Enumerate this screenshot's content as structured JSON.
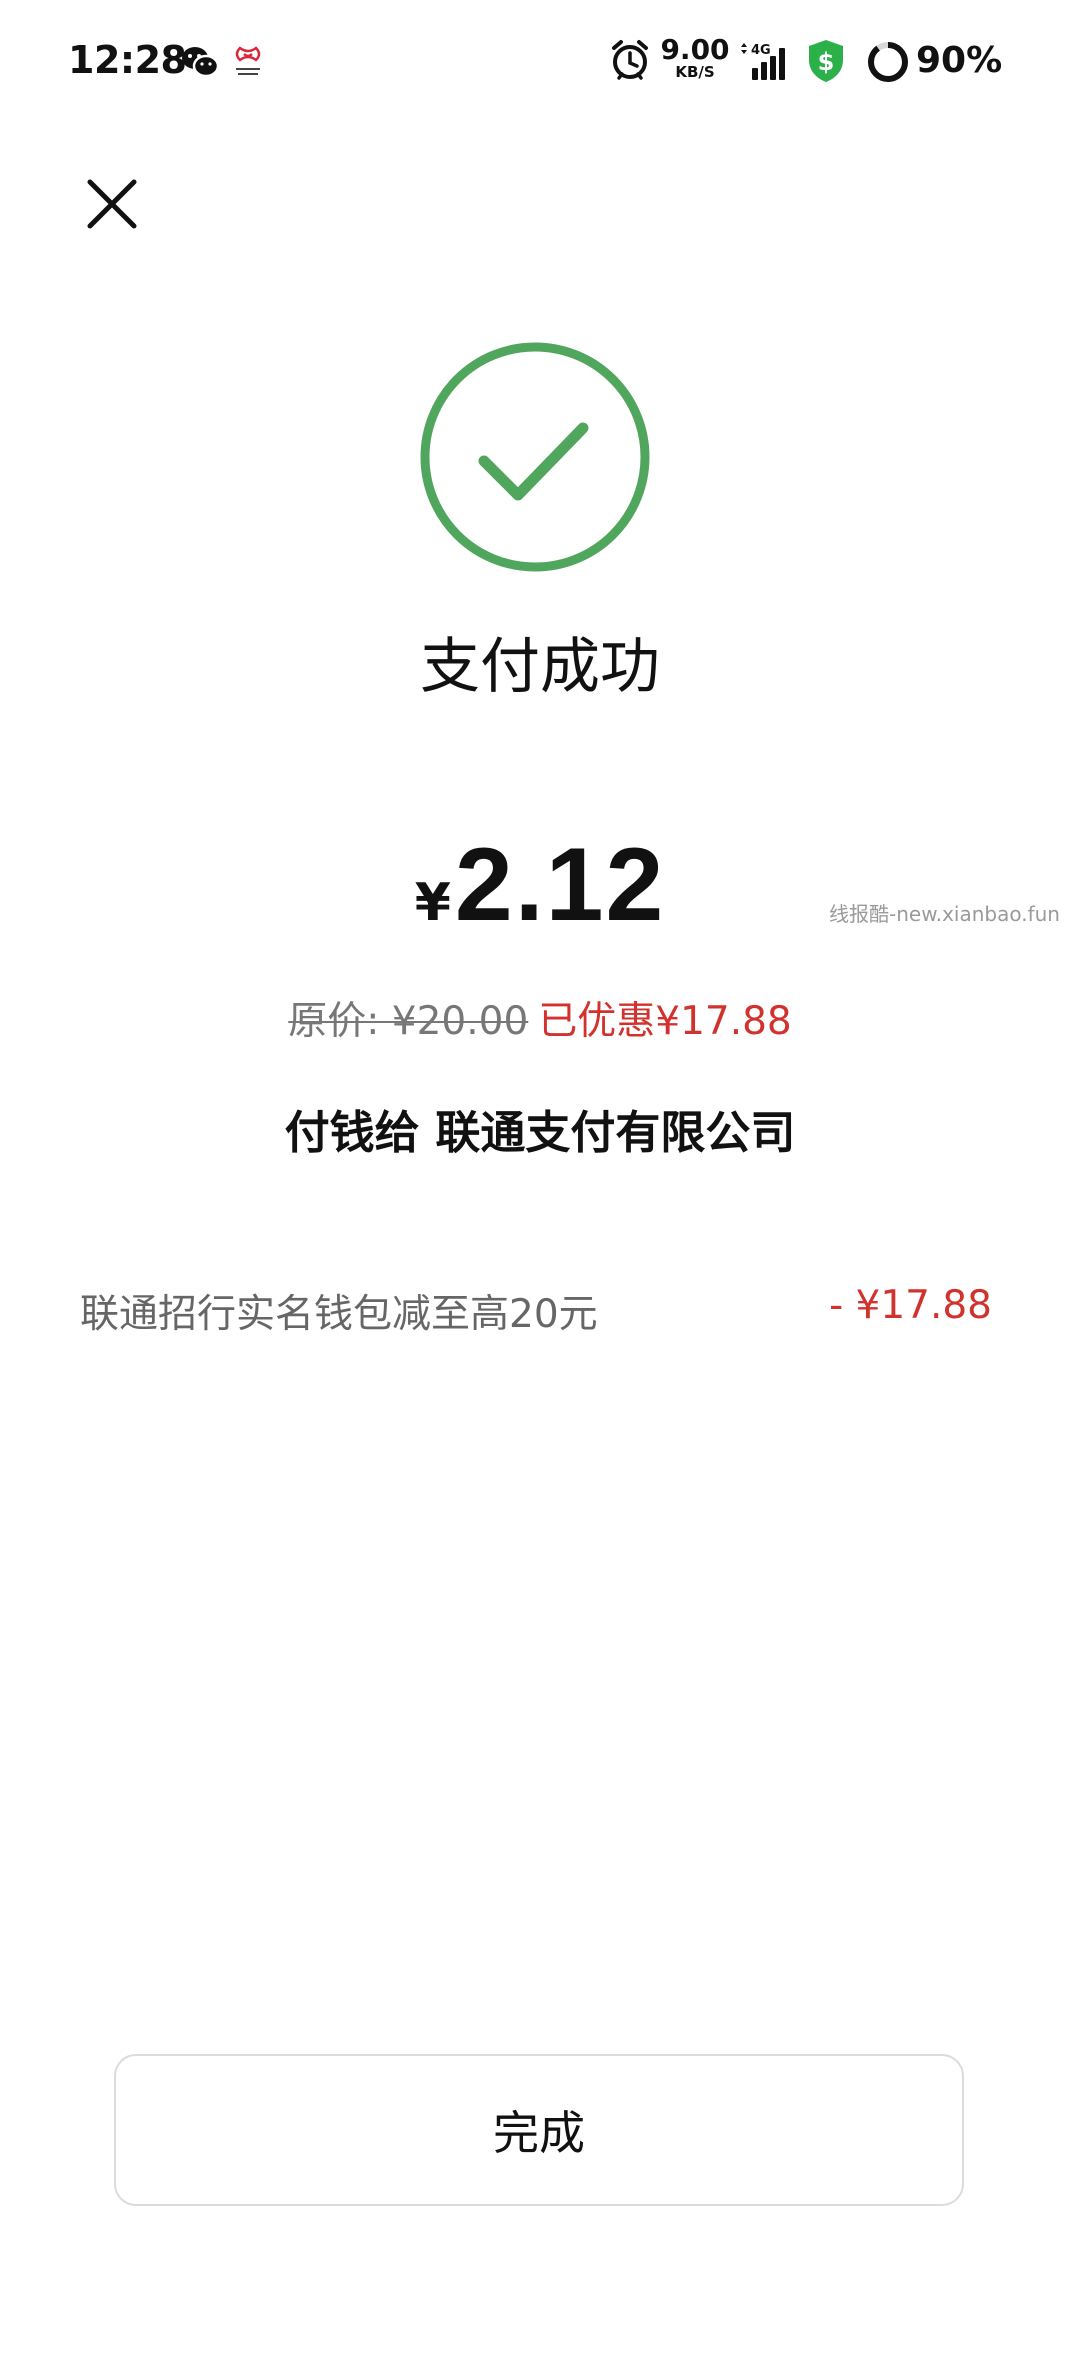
{
  "status_bar": {
    "time": "12:28",
    "net_speed_value": "9.00",
    "net_speed_unit": "KB/S",
    "network_type": "4G",
    "battery": "90%",
    "battery_level": 0.9,
    "app_icons": [
      "wechat-icon",
      "china-unicom-icon",
      "alarm-icon",
      "signal-icon",
      "security-shield-icon",
      "battery-ring-icon"
    ],
    "colors": {
      "shield": "#2cb14a"
    }
  },
  "header": {
    "close_icon": "close-icon"
  },
  "result": {
    "icon": "success-check-icon",
    "icon_color": "#4fa65c",
    "title": "支付成功"
  },
  "amount": {
    "currency": "¥",
    "value": "2.12"
  },
  "price": {
    "original_label": "原价: ¥20.00",
    "discount_label": "已优惠¥17.88"
  },
  "payee": {
    "text": "付钱给 联通支付有限公司"
  },
  "promotion": {
    "label": "联通招行实名钱包减至高20元",
    "amount": "- ¥17.88"
  },
  "watermark": "线报酷-new.xianbao.fun",
  "actions": {
    "done_label": "完成"
  },
  "colors": {
    "accent_red": "#d2322d",
    "success_green": "#4fa65c"
  }
}
